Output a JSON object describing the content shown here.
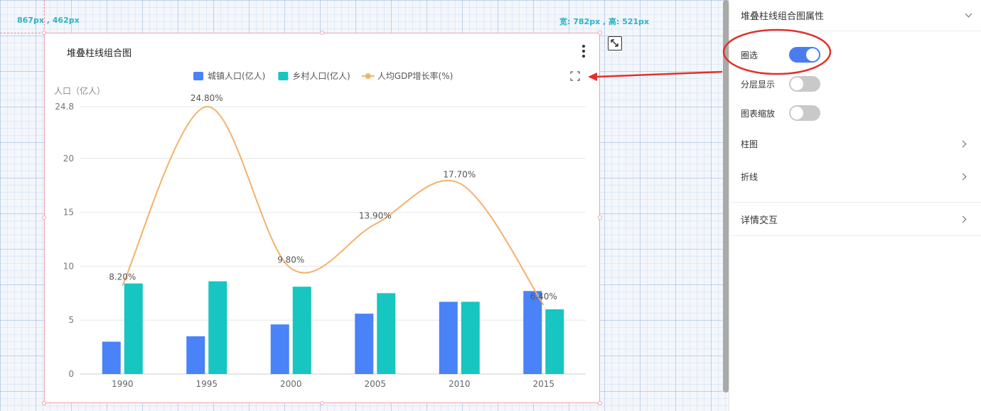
{
  "canvas": {
    "position_label": "867px , 462px",
    "size_label": "宽: 782px , 高: 521px"
  },
  "card": {
    "title": "堆叠柱线组合图"
  },
  "chart_data": {
    "type": "bar",
    "title": "堆叠柱线组合图",
    "categories": [
      "1990",
      "1995",
      "2000",
      "2005",
      "2010",
      "2015"
    ],
    "ylabel": "人口（亿人）",
    "y_ticks": [
      "0",
      "5",
      "10",
      "15",
      "20",
      "24.8"
    ],
    "ylim": [
      0,
      24.8
    ],
    "legend_position": "top-center",
    "series": [
      {
        "name": "城镇人口(亿人)",
        "type": "bar",
        "color": "#4a82f7",
        "values": [
          3.0,
          3.5,
          4.6,
          5.6,
          6.7,
          7.7
        ]
      },
      {
        "name": "乡村人口(亿人)",
        "type": "bar",
        "color": "#17c5c1",
        "values": [
          8.4,
          8.6,
          8.1,
          7.5,
          6.7,
          6.0
        ]
      },
      {
        "name": "人均GDP增长率(%)",
        "type": "line",
        "color": "#f3b26b",
        "values": [
          8.2,
          24.8,
          9.8,
          13.9,
          17.7,
          6.4
        ],
        "labels": [
          "8.20%",
          "24.80%",
          "9.80%",
          "13.90%",
          "17.70%",
          "6.40%"
        ]
      }
    ]
  },
  "panel": {
    "header": "堆叠柱线组合图属性",
    "toggles": [
      {
        "label": "圈选",
        "on": true
      },
      {
        "label": "分层显示",
        "on": false
      },
      {
        "label": "图表缩放",
        "on": false
      }
    ],
    "nav": [
      {
        "label": "柱图"
      },
      {
        "label": "折线"
      }
    ],
    "detail": {
      "label": "详情交互"
    }
  },
  "annotation": {
    "color": "#e0322b"
  }
}
